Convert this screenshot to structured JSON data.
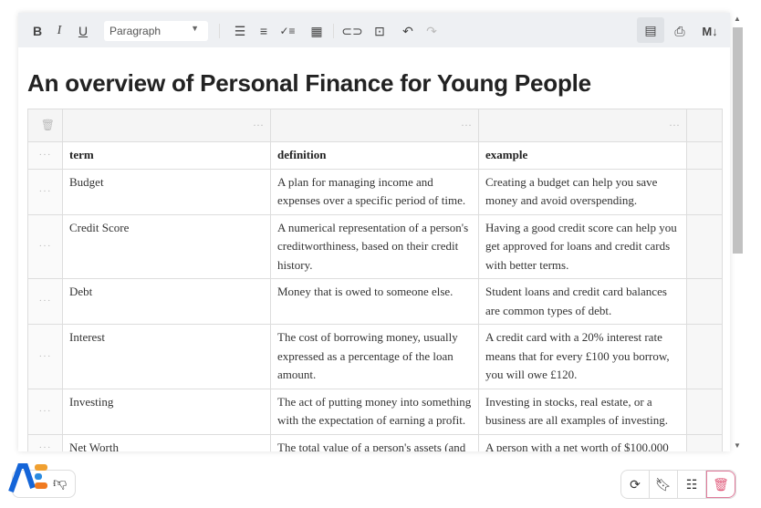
{
  "toolbar": {
    "bold": "B",
    "italic": "I",
    "underline": "U",
    "paragraph": "Paragraph",
    "markdown": "M↓"
  },
  "document": {
    "title": "An overview of Personal Finance for Young People"
  },
  "table": {
    "headers": [
      "term",
      "definition",
      "example"
    ],
    "rows": [
      [
        "Budget",
        "A plan for managing income and expenses over a specific period of time.",
        "Creating a budget can help you save money and avoid overspending."
      ],
      [
        "Credit Score",
        "A numerical representation of a person's creditworthiness, based on their credit history.",
        "Having a good credit score can help you get approved for loans and credit cards with better terms."
      ],
      [
        "Debt",
        "Money that is owed to someone else.",
        "Student loans and credit card balances are common types of debt."
      ],
      [
        "Interest",
        "The cost of borrowing money, usually expressed as a percentage of the loan amount.",
        "A credit card with a 20% interest rate means that for every £100 you borrow, you will owe £120."
      ],
      [
        "Investing",
        "The act of putting money into something with the expectation of earning a profit.",
        "Investing in stocks, real estate, or a business are all examples of investing."
      ],
      [
        "Net Worth",
        "The total value of a person's assets (and",
        "A person with a net worth of $100,000"
      ]
    ]
  },
  "colors": {
    "accent_delete": "#e05a7a",
    "toolbar_bg": "#eef0f3"
  }
}
